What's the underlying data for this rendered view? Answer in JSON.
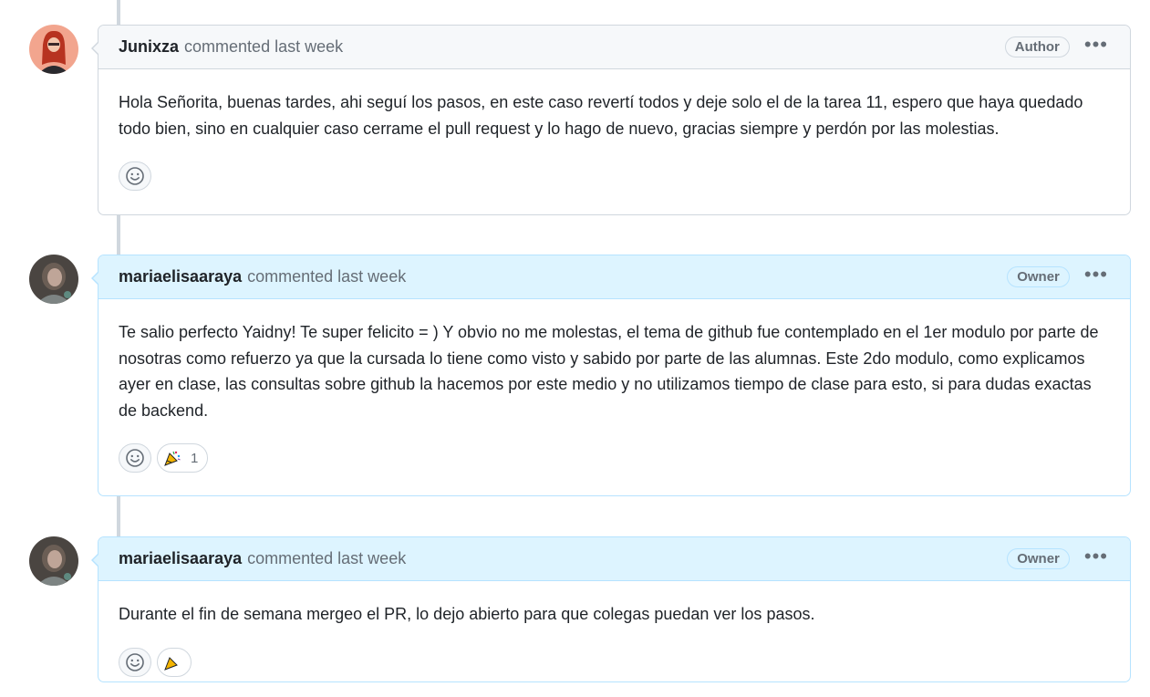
{
  "comments": [
    {
      "author": "Junixza",
      "meta": "commented last week",
      "role": "Author",
      "body": "Hola Señorita, buenas tardes, ahi seguí los pasos, en este caso revertí todos y deje solo el de la tarea 11, espero que haya quedado todo bien, sino en cualquier caso cerrame el pull request y lo hago de nuevo, gracias siempre y perdón por las molestias.",
      "reaction_count": ""
    },
    {
      "author": "mariaelisaaraya",
      "meta": "commented last week",
      "role": "Owner",
      "body": "Te salio perfecto Yaidny! Te super felicito = ) Y obvio no me molestas, el tema de github fue contemplado en el 1er modulo por parte de nosotras como refuerzo ya que la cursada lo tiene como visto y sabido por parte de las alumnas. Este 2do modulo, como explicamos ayer en clase, las consultas sobre github la hacemos por este medio y no utilizamos tiempo de clase para esto, si para dudas exactas de backend.",
      "reaction_count": "1"
    },
    {
      "author": "mariaelisaaraya",
      "meta": "commented last week",
      "role": "Owner",
      "body": "Durante el fin de semana mergeo el PR, lo dejo abierto para que colegas puedan ver los pasos.",
      "reaction_count": ""
    }
  ],
  "icons": {
    "more": "kebab-horizontal-icon",
    "add_reaction": "smiley-icon",
    "reaction": "tada-icon"
  },
  "colors": {
    "owner_header_bg": "#ddf4ff",
    "owner_border": "#b6e3ff",
    "default_header_bg": "#f6f8fa",
    "border": "#d0d7de",
    "muted_text": "#656d76"
  }
}
